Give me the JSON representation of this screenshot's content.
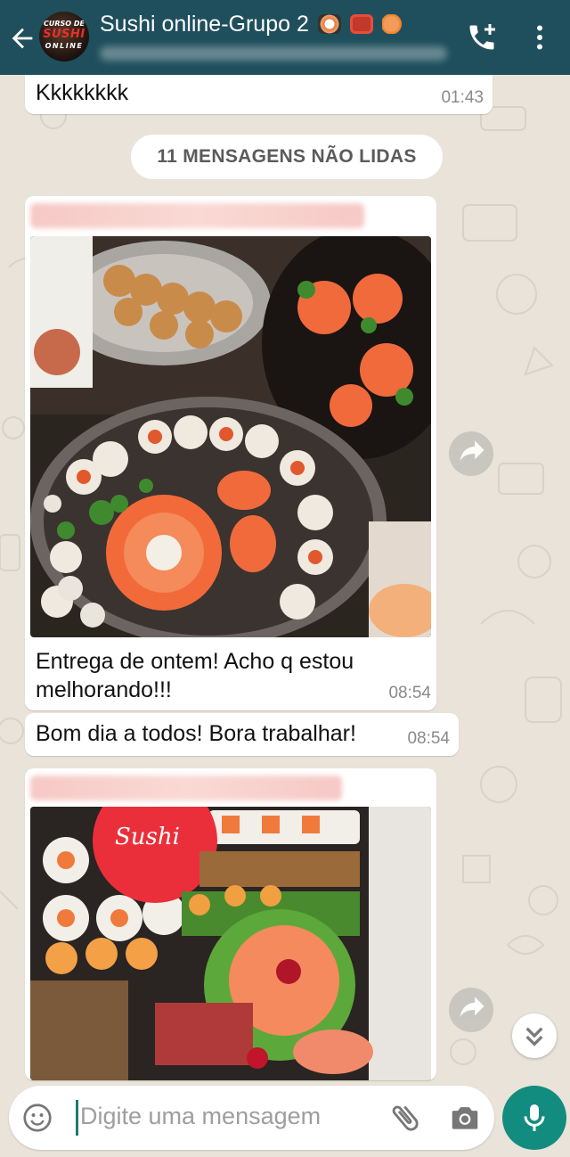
{
  "header": {
    "title": "Sushi online-Grupo 2",
    "avatar_text": [
      "CURSO DE",
      "SUSHI",
      "ONLINE"
    ],
    "title_emoji": [
      "sushi-emoji",
      "bento-emoji",
      "shrimp-emoji"
    ],
    "color": "#1f4f5c"
  },
  "messages": [
    {
      "text": "Kkkkkkkk",
      "time": "01:43"
    },
    {
      "caption": [
        "Entrega de ontem! Acho q estou",
        "melhorando!!!"
      ],
      "time": "08:54",
      "image": "sushi platter photo"
    },
    {
      "text": "Bom dia a todos! Bora trabalhar!",
      "time": "08:54"
    },
    {
      "image": "sushi delivery box photo"
    }
  ],
  "unread_banner": "11 MENSAGENS NÃO LIDAS",
  "input": {
    "placeholder": "Digite uma mensagem"
  },
  "colors": {
    "accent": "#128c7e",
    "header": "#1f4f5c",
    "background": "#e9e3da",
    "bubble": "#ffffff"
  }
}
